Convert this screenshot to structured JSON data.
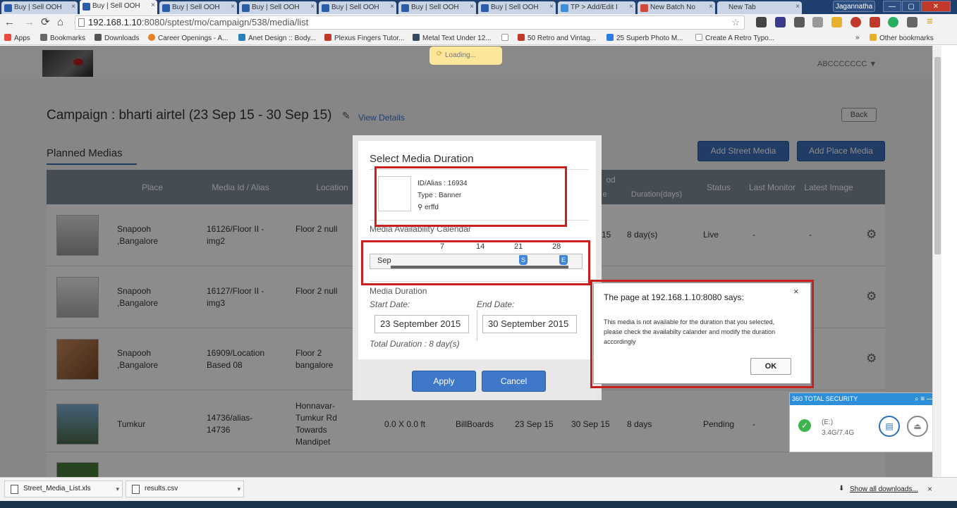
{
  "browser": {
    "tabs": [
      {
        "title": "Buy | Sell OOH"
      },
      {
        "title": "Buy | Sell OOH"
      },
      {
        "title": "Buy | Sell OOH"
      },
      {
        "title": "Buy | Sell OOH"
      },
      {
        "title": "Buy | Sell OOH"
      },
      {
        "title": "Buy | Sell OOH"
      },
      {
        "title": "Buy | Sell OOH"
      },
      {
        "title": "TP > Add/Edit I"
      },
      {
        "title": "New Batch No"
      },
      {
        "title": "New Tab"
      }
    ],
    "profile_name": "Jagannatha",
    "url_host": "192.168.1.10",
    "url_rest": ":8080/sptest/mo/campaign/538/media/list",
    "bookmarks": [
      "Apps",
      "Bookmarks",
      "Downloads",
      "Career Openings - A...",
      "Anet Design :: Body...",
      "Plexus Fingers Tutor...",
      "Metal Text Under 12...",
      "50 Retro and Vintag...",
      "25 Superb Photo M...",
      "Create A Retro Typo..."
    ],
    "other_bookmarks": "Other bookmarks",
    "chevron": "»"
  },
  "app": {
    "loading_text": "Loading...",
    "user_name": "ABCCCCCCC",
    "campaign_title": "Campaign : bharti airtel (23 Sep 15 - 30 Sep 15)",
    "view_details": "View Details",
    "back": "Back",
    "planned_medias": "Planned Medias",
    "add_street_media": "Add Street Media",
    "add_place_media": "Add Place Media"
  },
  "table": {
    "headers": {
      "place": "Place",
      "media_id": "Media Id / Alias",
      "location": "Location",
      "period": "od",
      "e": "e",
      "duration": "Duration(days)",
      "status": "Status",
      "last_monitor": "Last Monitor",
      "latest_image": "Latest Image"
    },
    "rows": [
      {
        "place": "Snapooh ,Bangalore",
        "media_id": "16126/Floor II - img2",
        "location": "Floor 2 null",
        "end": "15",
        "duration": "8 day(s)",
        "status": "Live",
        "last_monitor": "-",
        "latest_image": "-"
      },
      {
        "place": "Snapooh ,Bangalore",
        "media_id": "16127/Floor II - img3",
        "location": "Floor 2 null"
      },
      {
        "place": "Snapooh ,Bangalore",
        "media_id": "16909/Location Based 08",
        "location": "Floor 2 bangalore"
      },
      {
        "place": "Tumkur",
        "media_id": "14736/alias-14736",
        "location": "Honnavar-Tumkur Rd Towards Mandipet",
        "size": "0.0 X 0.0 ft",
        "type": "BillBoards",
        "start": "23 Sep 15",
        "end": "30 Sep 15",
        "duration": "8 days",
        "status": "Pending",
        "last_monitor": "-"
      }
    ]
  },
  "modal": {
    "title": "Select Media Duration",
    "media_id": "ID/Alias : 16934",
    "media_type": "Type : Banner",
    "media_location": "erffd",
    "calendar_label": "Media Availability Calendar",
    "calendar_days": [
      "7",
      "14",
      "21",
      "28"
    ],
    "calendar_month": "Sep",
    "pin_start": "S",
    "pin_end": "E",
    "duration_label": "Media Duration",
    "start_label": "Start Date:",
    "end_label": "End Date:",
    "start_value": "23 September 2015",
    "end_value": "30 September 2015",
    "total_duration": "Total Duration : 8 day(s)",
    "apply": "Apply",
    "cancel": "Cancel"
  },
  "alert": {
    "title": "The page at 192.168.1.10:8080 says:",
    "message": "This media is not available for the duration that you selected, please check the availabilty calander and modify the duration accordingly",
    "ok": "OK",
    "close": "×"
  },
  "security": {
    "title": "360 TOTAL SECURITY",
    "drive": "(E:)",
    "usage": "3.4G/7.4G"
  },
  "downloads": {
    "items": [
      "Street_Media_List.xls",
      "results.csv"
    ],
    "show_all": "Show all downloads...",
    "close": "×"
  },
  "colors": {
    "accent": "#3c6eb9",
    "highlight": "#c8201f",
    "table_header": "#7f8a99",
    "security_blue": "#2d8fd8"
  }
}
